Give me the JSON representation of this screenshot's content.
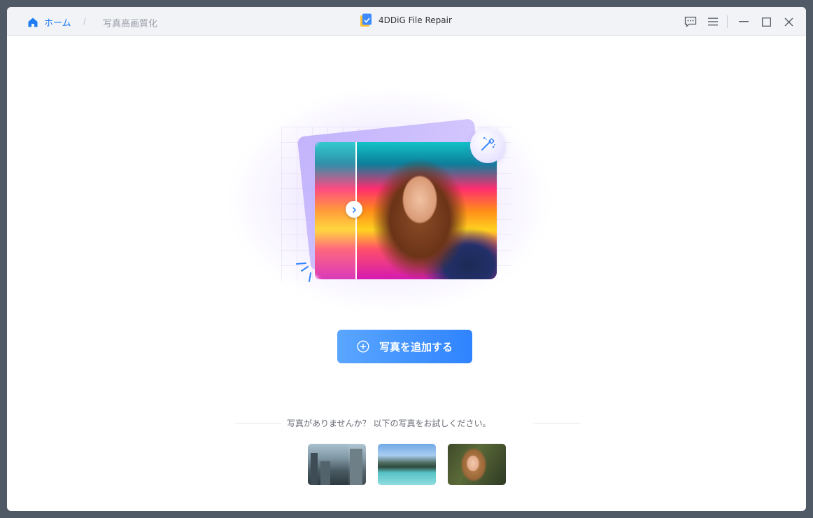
{
  "breadcrumb": {
    "home_label": "ホーム",
    "separator": "/",
    "current": "写真高画質化"
  },
  "app": {
    "title": "4DDiG File Repair"
  },
  "window_controls": {
    "feedback_icon": "chat-icon",
    "menu_icon": "hamburger-icon",
    "minimize_icon": "minimize-icon",
    "maximize_icon": "maximize-icon",
    "close_icon": "close-icon"
  },
  "hero": {
    "image_description_icon": "wand-icon"
  },
  "actions": {
    "add_photo_label": "写真を追加する"
  },
  "samples": {
    "prompt": "写真がありませんか？ 以下の写真をお試しください。",
    "items": [
      "city",
      "lake",
      "portrait"
    ]
  },
  "colors": {
    "accent": "#1f7cf2",
    "button_start": "#5aa6ff",
    "button_end": "#2f83ff"
  }
}
